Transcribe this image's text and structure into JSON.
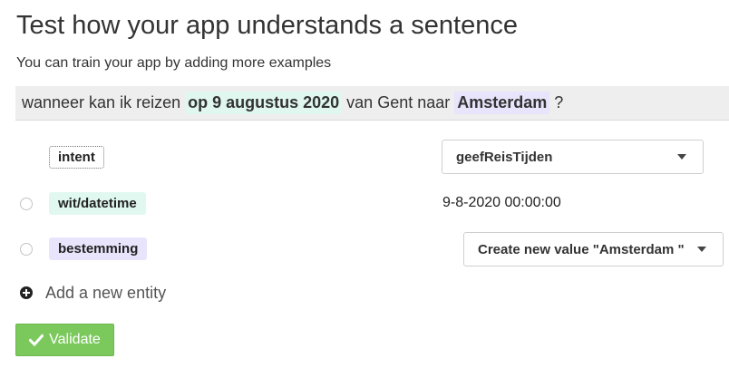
{
  "header": {
    "title": "Test how your app understands a sentence",
    "subtitle": "You can train your app by adding more examples"
  },
  "sentence": {
    "part1": "wanneer kan ik reizen ",
    "entity_date": "op 9 augustus 2020",
    "part2": " van Gent naar ",
    "entity_destination": "Amsterdam",
    "part3": " ?"
  },
  "entities": {
    "intent": {
      "tag": "intent",
      "selected": "geefReisTijden"
    },
    "datetime": {
      "tag": "wit/datetime",
      "value": "9-8-2020 00:00:00"
    },
    "destination": {
      "tag": "bestemming",
      "selected": "Create new value \"Amsterdam \""
    }
  },
  "actions": {
    "add_entity_label": "Add a new entity",
    "validate_label": "Validate"
  },
  "colors": {
    "highlight_green": "#dff7ef",
    "highlight_purple": "#e8e4fb",
    "validate_green": "#7bc95c"
  },
  "icons": {
    "add": "plus-circle-icon",
    "validate": "check-icon",
    "dropdown": "caret-down-icon"
  }
}
